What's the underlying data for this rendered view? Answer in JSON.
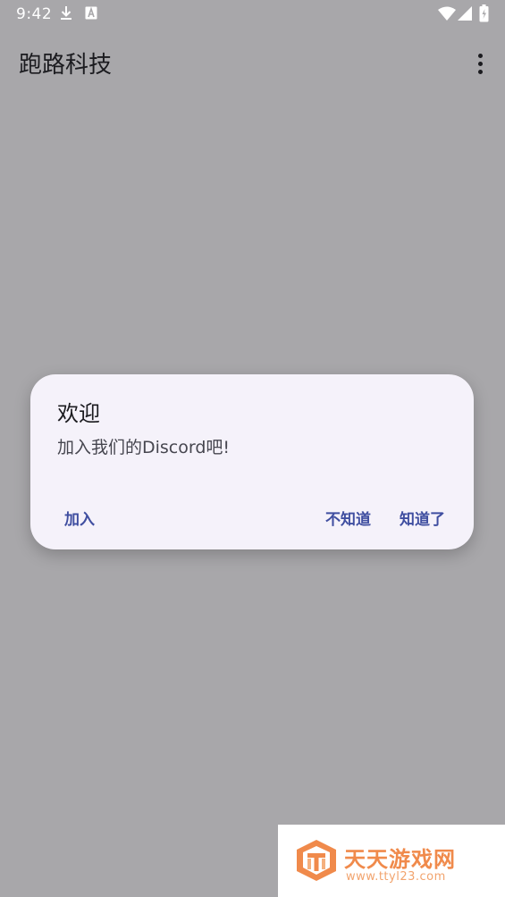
{
  "status_bar": {
    "time": "9:42",
    "icons": [
      "download-icon",
      "a-box-icon",
      "wifi-icon",
      "signal-icon",
      "battery-charging-icon"
    ]
  },
  "app_bar": {
    "title": "跑路科技",
    "menu_icon": "more-vert-icon"
  },
  "dialog": {
    "title": "欢迎",
    "message": "加入我们的Discord吧!",
    "buttons": {
      "join": "加入",
      "dont_know": "不知道",
      "got_it": "知道了"
    }
  },
  "watermark": {
    "title": "天天游戏网",
    "url": "www.ttyl23.com"
  },
  "colors": {
    "scrim_background": "#a8a7aa",
    "dialog_surface": "#f5f2fa",
    "button_text": "#3f4ea0",
    "watermark_orange": "#f08a4b"
  }
}
